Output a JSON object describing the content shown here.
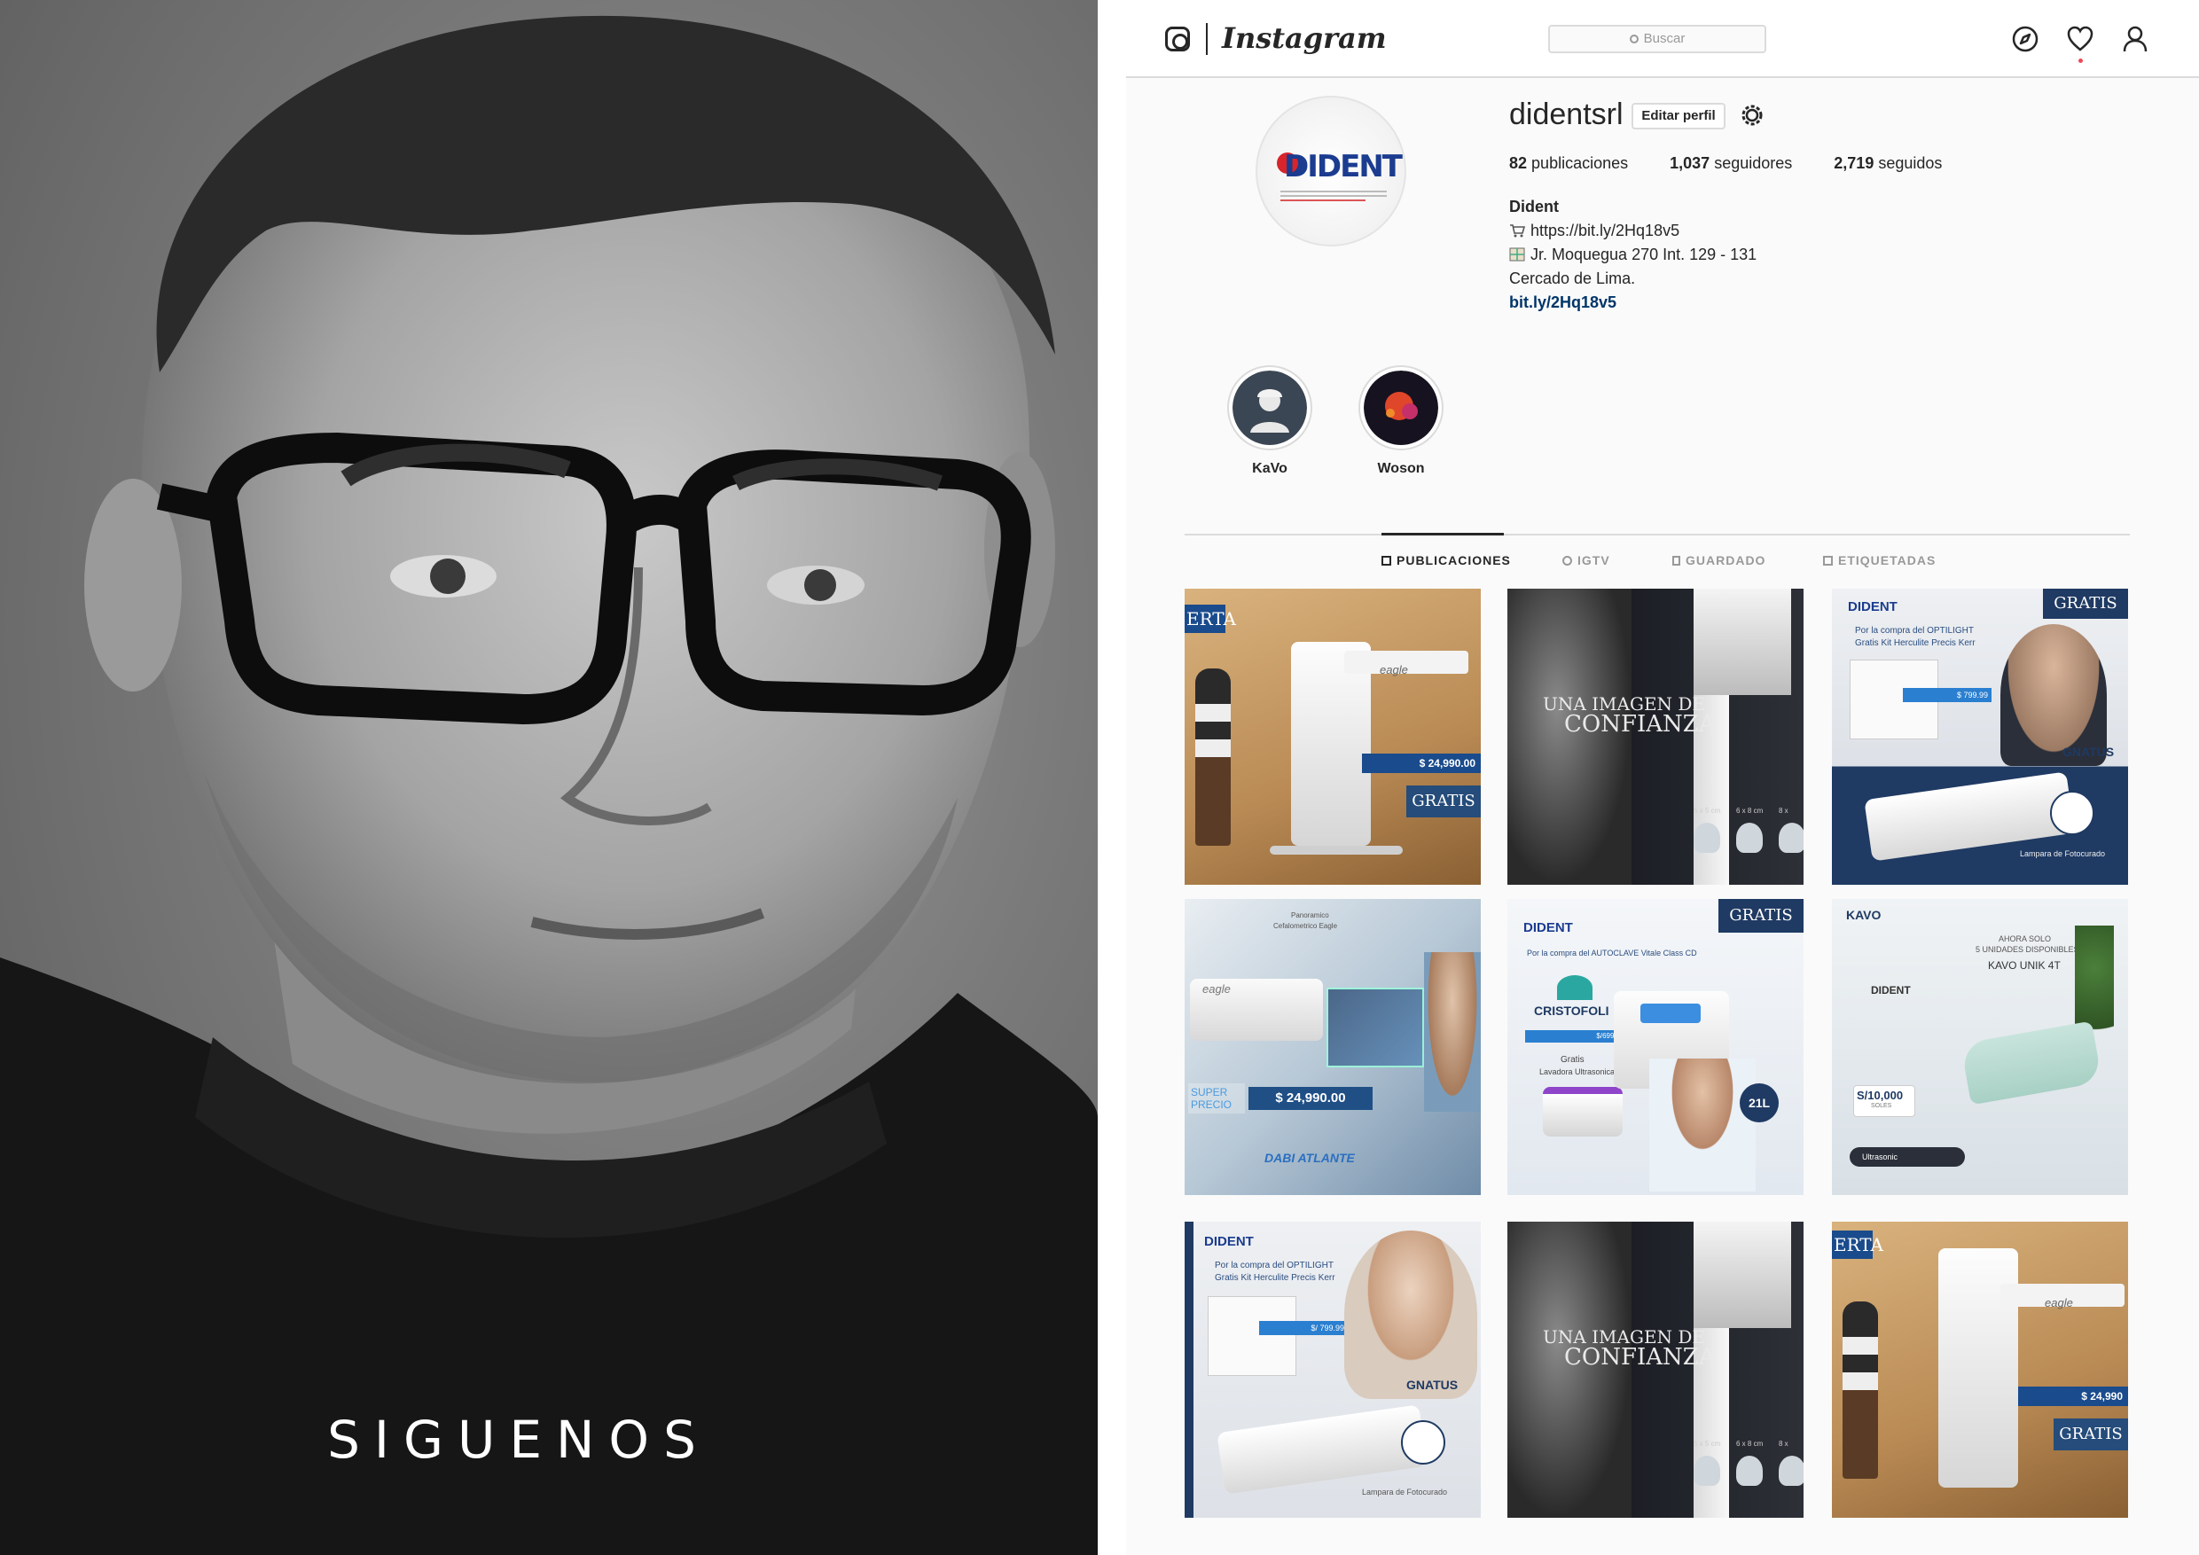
{
  "caption": "SIGUENOS",
  "topbar": {
    "wordmark": "Instagram",
    "search_placeholder": "Buscar",
    "icons": [
      "explore-icon",
      "heart-icon",
      "profile-icon"
    ]
  },
  "profile": {
    "username": "didentsrl",
    "edit_label": "Editar perfil",
    "avatar_brand": "DIDENT",
    "stats": {
      "posts_value": "82",
      "posts_label": "publicaciones",
      "followers_value": "1,037",
      "followers_label": "seguidores",
      "following_value": "2,719",
      "following_label": "seguidos"
    },
    "bio": {
      "name": "Dident",
      "line1": "https://bit.ly/2Hq18v5",
      "line2": "Jr. Moquegua 270 Int. 129 - 131",
      "line3": "Cercado de Lima.",
      "link": "bit.ly/2Hq18v5"
    }
  },
  "highlights": [
    {
      "label": "KaVo"
    },
    {
      "label": "Woson"
    }
  ],
  "tabs": [
    {
      "label": "PUBLICACIONES",
      "active": true
    },
    {
      "label": "IGTV",
      "active": false
    },
    {
      "label": "GUARDADO",
      "active": false
    },
    {
      "label": "ETIQUETADAS",
      "active": false
    }
  ],
  "posts": {
    "p1": {
      "corner": "ERTA",
      "price": "$ 24,990.00",
      "badge": "GRATIS",
      "brand": "eagle"
    },
    "p2": {
      "headline1": "UNA IMAGEN DE",
      "headline2": "CONFIANZA",
      "sizes": [
        "5 x 5 cm",
        "6 x 8 cm",
        "8 x"
      ]
    },
    "p3": {
      "brand": "DIDENT",
      "badge": "GRATIS",
      "promo1": "Por la compra del OPTILIGHT",
      "promo2": "Gratis Kit Herculite Precis Kerr",
      "price": "$ 799.99",
      "gnatus": "GNATUS",
      "foot": "Lampara de Fotocurado"
    },
    "p4": {
      "top1": "Panoramico",
      "top2": "Cefalometrico Eagle",
      "brand": "eagle",
      "super": "SUPER PRECIO",
      "price": "$ 24,990.00",
      "foot": "DABI ATLANTE"
    },
    "p5": {
      "brand": "DIDENT",
      "badge": "GRATIS",
      "promo": "Por la compra del AUTOCLAVE Vitale Class CD",
      "cristofoli": "CRISTOFOLI",
      "price": "$/6999.99",
      "gift1": "Gratis",
      "gift2": "Lavadora Ultrasonica",
      "cap": "21L"
    },
    "p6": {
      "kavo": "KAVO",
      "line1": "AHORA SOLO",
      "line2": "5 UNIDADES DISPONIBLES",
      "line3": "KAVO UNIK 4T",
      "dident": "DIDENT",
      "price": "S/10,000",
      "soles": "SOLES",
      "foot": "Ultrasonic"
    },
    "p7": {
      "brand": "DIDENT",
      "promo1": "Por la compra del OPTILIGHT",
      "promo2": "Gratis Kit Herculite Precis Kerr",
      "price": "$/ 799.99",
      "gnatus": "GNATUS",
      "foot": "Lampara de Fotocurado"
    },
    "p8": {
      "headline1": "UNA IMAGEN DE",
      "headline2": "CONFIANZA",
      "sizes": [
        "5 x 5 cm",
        "6 x 8 cm",
        "8 x"
      ]
    },
    "p9": {
      "corner": "ERTA",
      "price": "$ 24,990",
      "badge": "GRATIS",
      "brand": "eagle"
    }
  },
  "colors": {
    "link": "#003569",
    "text": "#262626",
    "border": "#dbdbdb",
    "bg": "#fafafa",
    "accent_red": "#ed4956"
  }
}
